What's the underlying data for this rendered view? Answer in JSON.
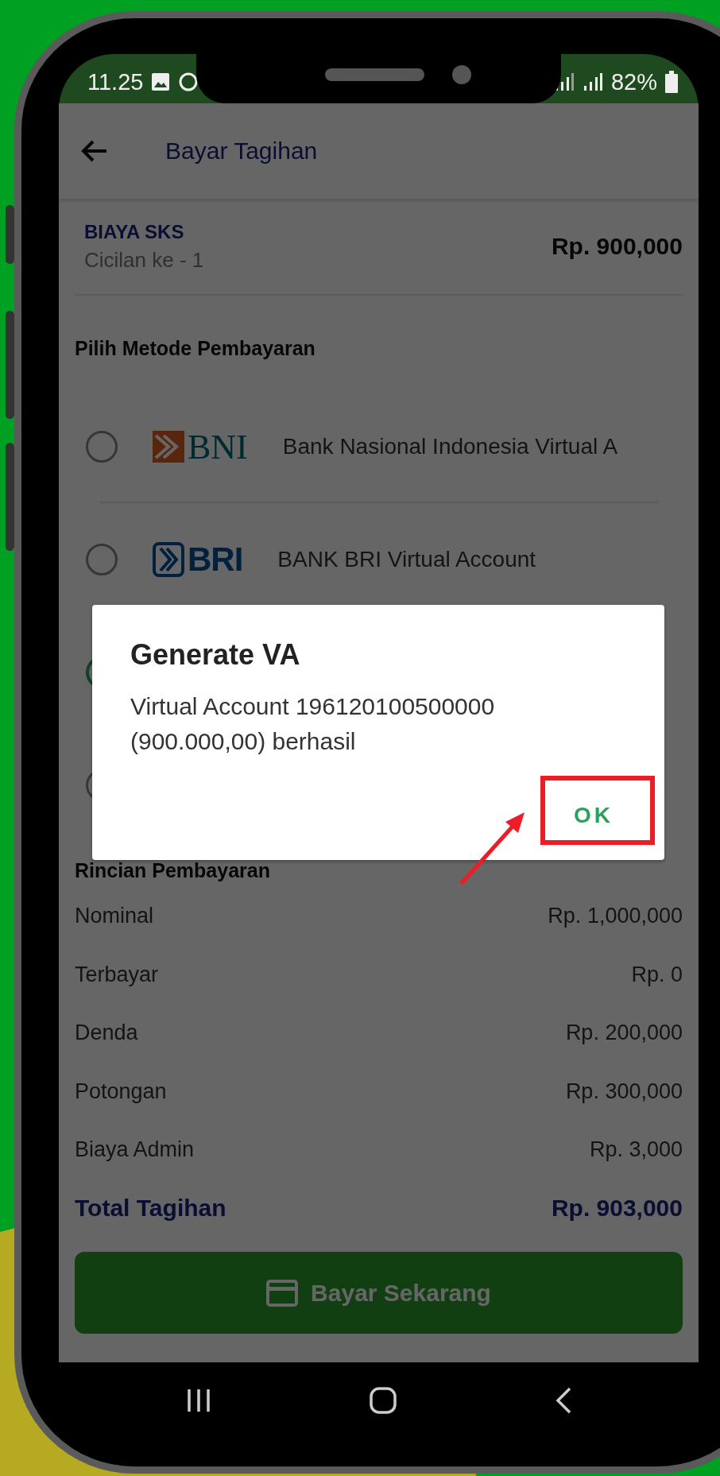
{
  "status_bar": {
    "time": "11.25",
    "battery": "82%"
  },
  "app_bar": {
    "title": "Bayar Tagihan"
  },
  "bill": {
    "name": "BIAYA SKS",
    "installment": "Cicilan ke - 1",
    "amount": "Rp. 900,000"
  },
  "payment_section": {
    "title": "Pilih Metode Pembayaran",
    "methods": [
      {
        "kind": "bni",
        "logo_text": "BNI",
        "label": "Bank Nasional Indonesia Virtual A",
        "selected": false
      },
      {
        "kind": "bri",
        "logo_text": "BRI",
        "label": "BANK BRI Virtual Account",
        "selected": false
      },
      {
        "selected": true
      },
      {
        "selected": false
      }
    ]
  },
  "details": {
    "title": "Rincian Pembayaran",
    "rows": [
      {
        "label": "Nominal",
        "value": "Rp. 1,000,000"
      },
      {
        "label": "Terbayar",
        "value": "Rp. 0"
      },
      {
        "label": "Denda",
        "value": "Rp. 200,000"
      },
      {
        "label": "Potongan",
        "value": "Rp. 300,000"
      },
      {
        "label": "Biaya Admin",
        "value": "Rp. 3,000"
      }
    ],
    "total": {
      "label": "Total Tagihan",
      "value": "Rp. 903,000"
    }
  },
  "pay_button": {
    "label": "Bayar Sekarang"
  },
  "dialog": {
    "title": "Generate VA",
    "message": "Virtual Account 196120100500000 (900.000,00) berhasil",
    "button": "OK"
  }
}
